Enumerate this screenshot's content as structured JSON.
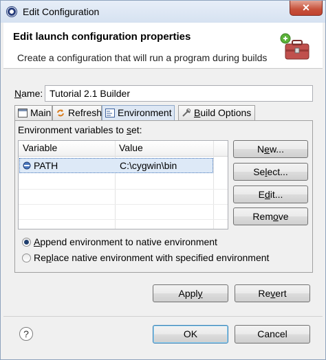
{
  "window": {
    "title": "Edit Configuration",
    "close_glyph": "✕"
  },
  "header": {
    "title": "Edit launch configuration properties",
    "description": "Create a configuration that will run a program during builds",
    "icon": "toolbox-icon"
  },
  "name_field": {
    "label_u": "N",
    "label_rest": "ame:",
    "value": "Tutorial 2.1 Builder"
  },
  "tabs": [
    {
      "label": "Main",
      "icon": "main-tab-icon"
    },
    {
      "label": "Refresh",
      "icon": "refresh-icon"
    },
    {
      "label": "Environment",
      "icon": "environment-icon",
      "active": true
    },
    {
      "label_u": "B",
      "label_rest": "uild Options",
      "icon": "build-options-icon"
    }
  ],
  "environment": {
    "section_label_pre": "Environment variables to ",
    "section_label_u": "s",
    "section_label_post": "et:",
    "columns": [
      "Variable",
      "Value"
    ],
    "rows": [
      {
        "variable": "PATH",
        "value": "C:\\cygwin\\bin",
        "selected": true
      }
    ],
    "buttons": {
      "new": {
        "pre": "N",
        "u": "e",
        "post": "w..."
      },
      "select": {
        "pre": "Se",
        "u": "l",
        "post": "ect..."
      },
      "edit": {
        "pre": "E",
        "u": "d",
        "post": "it..."
      },
      "remove": {
        "pre": "Rem",
        "u": "o",
        "post": "ve"
      }
    },
    "options": {
      "append": {
        "u": "A",
        "rest": "ppend environment to native environment",
        "checked": true
      },
      "replace": {
        "pre": "Re",
        "u": "p",
        "rest": "lace native environment with specified environment",
        "checked": false
      }
    }
  },
  "actions": {
    "apply": {
      "pre": "Appl",
      "u": "y",
      "post": ""
    },
    "revert": {
      "pre": "Re",
      "u": "v",
      "post": "ert"
    }
  },
  "footer": {
    "help": "?",
    "ok": "OK",
    "cancel": "Cancel"
  },
  "colors": {
    "accent": "#3c7fb1",
    "selection": "#dde9f7",
    "close": "#c7513a"
  }
}
